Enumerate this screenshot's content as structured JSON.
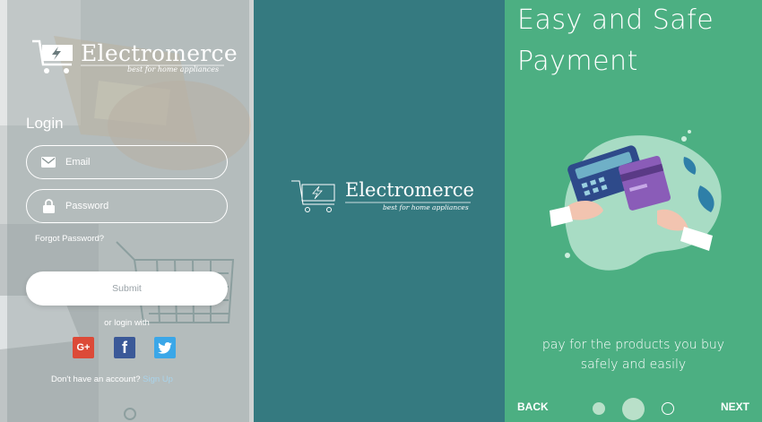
{
  "login_screen": {
    "brand_name": "Electromerce",
    "brand_tagline": "best for home appliances",
    "title": "Login",
    "email_placeholder": "Email",
    "password_placeholder": "Password",
    "forgot_password": "Forgot Password?",
    "submit_label": "Submit",
    "or_login_with": "or login with",
    "social": [
      {
        "name": "Google+",
        "glyph": "G+",
        "color": "#dc4a38"
      },
      {
        "name": "Facebook",
        "glyph": "f",
        "color": "#3b5998"
      },
      {
        "name": "Twitter",
        "icon": "twitter-bird-icon",
        "color": "#3ba7e8"
      }
    ],
    "no_account_text": "Don't have an account?",
    "signup_link": "Sign Up"
  },
  "splash_screen": {
    "brand_name": "Electromerce",
    "brand_tagline": "best for home appliances",
    "background": "#357a80"
  },
  "onboarding_screen": {
    "title": "Easy and Safe Payment",
    "caption_line1": "pay for the products you buy",
    "caption_line2": "safely and easily",
    "back_label": "BACK",
    "next_label": "NEXT",
    "page_count": 3,
    "active_page": 2,
    "background": "#4caf82"
  }
}
